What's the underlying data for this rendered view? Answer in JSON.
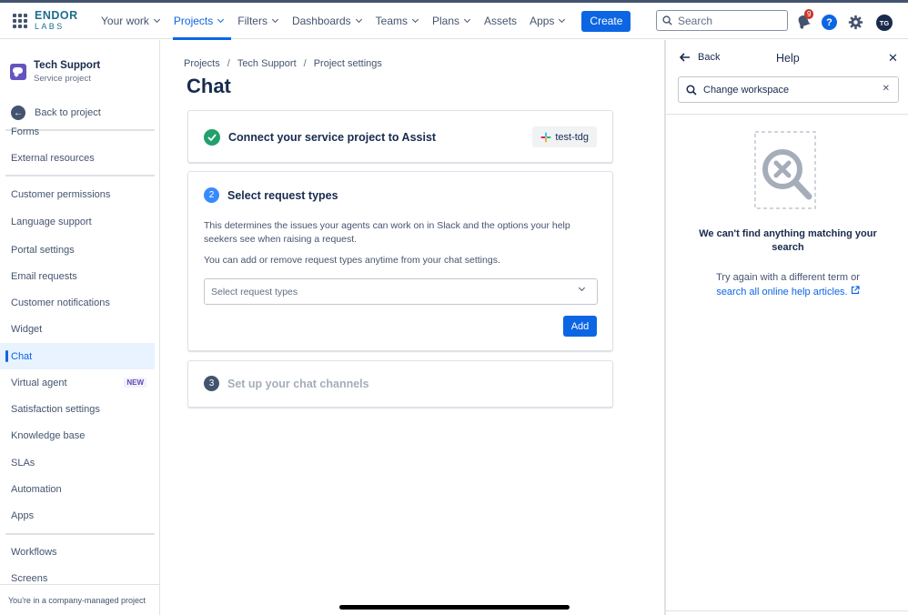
{
  "topnav": {
    "logo_line1": "ENDOR",
    "logo_line2": "LABS",
    "items": [
      {
        "label": "Your work",
        "dropdown": true,
        "active": false
      },
      {
        "label": "Projects",
        "dropdown": true,
        "active": true
      },
      {
        "label": "Filters",
        "dropdown": true,
        "active": false
      },
      {
        "label": "Dashboards",
        "dropdown": true,
        "active": false
      },
      {
        "label": "Teams",
        "dropdown": true,
        "active": false
      },
      {
        "label": "Plans",
        "dropdown": true,
        "active": false
      },
      {
        "label": "Assets",
        "dropdown": false,
        "active": false
      },
      {
        "label": "Apps",
        "dropdown": true,
        "active": false
      }
    ],
    "create_label": "Create",
    "search_placeholder": "Search",
    "notification_count": "9",
    "help_glyph": "?",
    "avatar_initials": "TG"
  },
  "sidebar": {
    "project_name": "Tech Support",
    "project_type": "Service project",
    "back_label": "Back to project",
    "items": [
      {
        "label": "Forms",
        "active": false,
        "badge": ""
      },
      {
        "label": "External resources",
        "active": false,
        "badge": ""
      },
      {
        "label": "Customer permissions",
        "active": false,
        "badge": ""
      },
      {
        "label": "Language support",
        "active": false,
        "badge": ""
      },
      {
        "label": "Portal settings",
        "active": false,
        "badge": ""
      },
      {
        "label": "Email requests",
        "active": false,
        "badge": ""
      },
      {
        "label": "Customer notifications",
        "active": false,
        "badge": ""
      },
      {
        "label": "Widget",
        "active": false,
        "badge": ""
      },
      {
        "label": "Chat",
        "active": true,
        "badge": ""
      },
      {
        "label": "Virtual agent",
        "active": false,
        "badge": "NEW"
      },
      {
        "label": "Satisfaction settings",
        "active": false,
        "badge": ""
      },
      {
        "label": "Knowledge base",
        "active": false,
        "badge": ""
      },
      {
        "label": "SLAs",
        "active": false,
        "badge": ""
      },
      {
        "label": "Automation",
        "active": false,
        "badge": ""
      },
      {
        "label": "Apps",
        "active": false,
        "badge": ""
      },
      {
        "label": "Workflows",
        "active": false,
        "badge": ""
      },
      {
        "label": "Screens",
        "active": false,
        "badge": ""
      }
    ],
    "footer": "You're in a company-managed project"
  },
  "main": {
    "breadcrumbs": [
      "Projects",
      "Tech Support",
      "Project settings"
    ],
    "title": "Chat",
    "step1": {
      "title": "Connect your service project to Assist",
      "workspace": "test-tdg"
    },
    "step2": {
      "number": "2",
      "title": "Select request types",
      "desc1": "This determines the issues your agents can work on in Slack and the options your help seekers see when raising a request.",
      "desc2": "You can add or remove request types anytime from your chat settings.",
      "select_placeholder": "Select request types",
      "add_label": "Add"
    },
    "step3": {
      "number": "3",
      "title": "Set up your chat channels"
    }
  },
  "help": {
    "back_label": "Back",
    "title": "Help",
    "search_value": "Change workspace",
    "empty_title": "We can't find anything matching your search",
    "empty_sub": "Try again with a different term or",
    "empty_link": "search all online help articles."
  },
  "colors": {
    "primary": "#0c66e4",
    "success": "#22a06b",
    "text": "#172b4d"
  }
}
